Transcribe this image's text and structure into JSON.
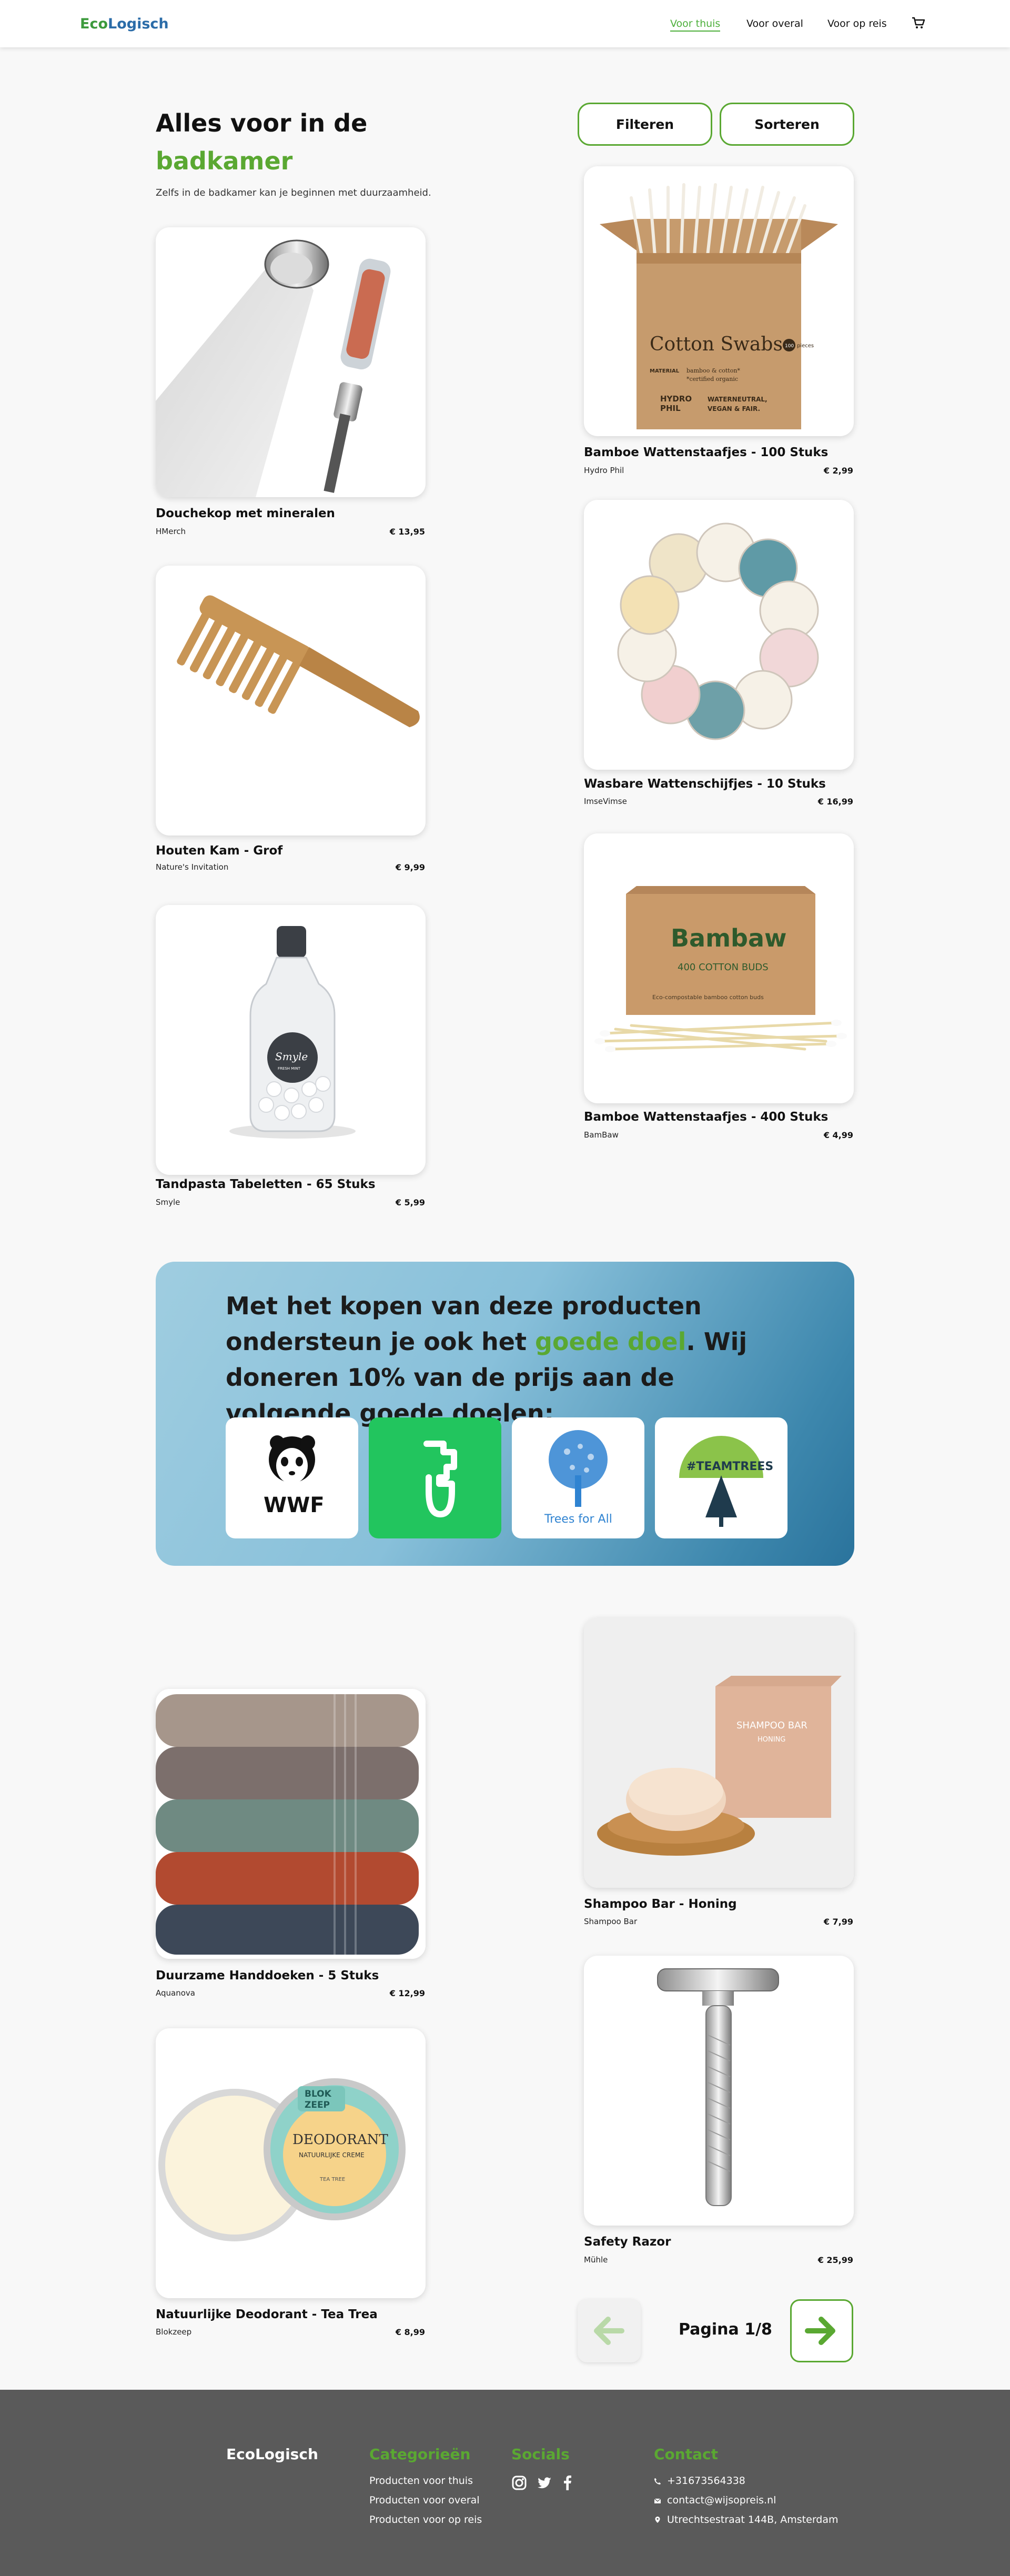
{
  "nav": {
    "logo_part1": "Eco",
    "logo_part2": "Logisch",
    "links": [
      "Voor thuis",
      "Voor overal",
      "Voor op reis"
    ]
  },
  "hero": {
    "title_line1": "Alles voor in de",
    "title_line2": "badkamer",
    "subtitle": "Zelfs in de badkamer kan je beginnen met duurzaamheid."
  },
  "toolbar": {
    "filter_label": "Filteren",
    "sort_label": "Sorteren"
  },
  "products": [
    {
      "name": "Douchekop met mineralen",
      "brand": "HMerch",
      "price": "€ 13,95",
      "image": "shower-head"
    },
    {
      "name": "Bamboe Wattenstaafjes - 100 Stuks",
      "brand": "Hydro Phil",
      "price": "€ 2,99",
      "image": "cotton-swabs-box"
    },
    {
      "name": "Houten Kam - Grof",
      "brand": "Nature's Invitation",
      "price": "€ 9,99",
      "image": "wooden-comb"
    },
    {
      "name": "Wasbare Wattenschijfjes - 10 Stuks",
      "brand": "ImseVimse",
      "price": "€ 16,99",
      "image": "cotton-pads"
    },
    {
      "name": "Tandpasta Tabeletten - 65 Stuks",
      "brand": "Smyle",
      "price": "€ 5,99",
      "image": "toothpaste-jar"
    },
    {
      "name": "Bamboe Wattenstaafjes - 400 Stuks",
      "brand": "BamBaw",
      "price": "€ 4,99",
      "image": "bambaw-box"
    },
    {
      "name": "Duurzame Handdoeken - 5 Stuks",
      "brand": "Aquanova",
      "price": "€ 12,99",
      "image": "towels"
    },
    {
      "name": "Shampoo Bar - Honing",
      "brand": "Shampoo Bar",
      "price": "€ 7,99",
      "image": "shampoo-bar"
    },
    {
      "name": "Natuurlijke Deodorant - Tea Trea",
      "brand": "Blokzeep",
      "price": "€ 8,99",
      "image": "deodorant-tin"
    },
    {
      "name": "Safety Razor",
      "brand": "Mühle",
      "price": "€ 25,99",
      "image": "safety-razor"
    }
  ],
  "product_image_text": {
    "cotton_swabs_title": "Cotton Swabs",
    "cotton_swabs_count": "100",
    "cotton_swabs_count_unit": "pieces",
    "cotton_swabs_material_label": "MATERIAL",
    "cotton_swabs_material_1": "bamboo & cotton*",
    "cotton_swabs_material_2": "*certified organic",
    "cotton_swabs_brand_1": "HYDRO",
    "cotton_swabs_brand_2": "PHIL",
    "cotton_swabs_claim_1": "WATERNEUTRAL,",
    "cotton_swabs_claim_2": "VEGAN & FAIR.",
    "smyle_logo": "Smyle",
    "smyle_sub": "FRESH MINT",
    "bambaw_logo": "Bambaw",
    "bambaw_sub": "400 COTTON BUDS",
    "bambaw_tagline": "Eco-compostable bamboo cotton buds",
    "shampoo_bar_label": "SHAMPOO BAR",
    "shampoo_bar_sub": "HONING",
    "deodorant_brand_1": "BLOK",
    "deodorant_brand_2": "ZEEP",
    "deodorant_name": "DEODORANT",
    "deodorant_sub": "NATUURLIJKE CREME",
    "deodorant_variant": "TEA TREE"
  },
  "banner": {
    "text_before": "Met het kopen van deze producten ondersteun je ook het ",
    "text_highlight": "goede doel",
    "text_after": ". Wij doneren 10% van de prijs aan de volgende goede doelen:",
    "charities": [
      {
        "name": "wwf-logo",
        "label": "WWF"
      },
      {
        "name": "green-logo",
        "label": ""
      },
      {
        "name": "trees-for-all-logo",
        "label": "Trees for All"
      },
      {
        "name": "team-trees-logo",
        "label": "#TEAMTREES"
      }
    ]
  },
  "pagination": {
    "label": "Pagina 1/8"
  },
  "footer": {
    "brand": "EcoLogisch",
    "categories_title": "Categorieën",
    "categories": [
      "Producten voor thuis",
      "Producten voor overal",
      "Producten voor op reis"
    ],
    "socials_title": "Socials",
    "socials": [
      "instagram-icon",
      "twitter-icon",
      "facebook-icon"
    ],
    "contact_title": "Contact",
    "contact": {
      "phone": "+31673564338",
      "email": "contact@wijsopreis.nl",
      "address": "Utrechtsestraat 144B, Amsterdam"
    }
  },
  "colors": {
    "accent": "#5aa832",
    "logo_blue": "#2b6ca8",
    "footer_bg": "#5a5a5a",
    "banner_start": "#9fcde0",
    "banner_end": "#2a739c"
  }
}
